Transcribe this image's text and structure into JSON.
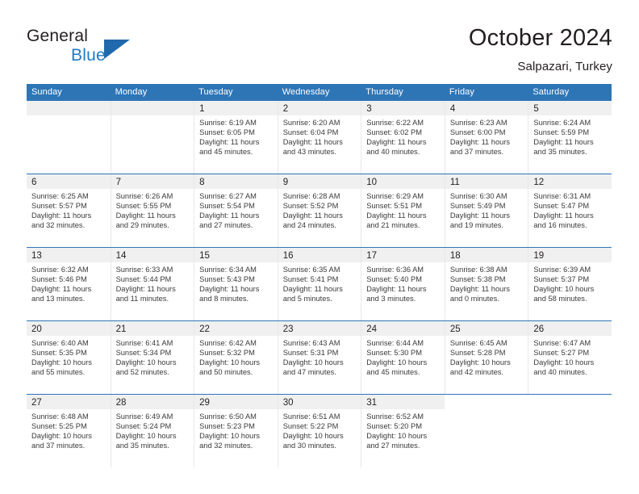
{
  "brand": {
    "name_top": "General",
    "name_bottom": "Blue",
    "logo_icon": "triangle-logo-icon",
    "accent_color": "#2069ac"
  },
  "header": {
    "title": "October 2024",
    "subtitle": "Salpazari, Turkey"
  },
  "colors": {
    "header_blue": "#2e75b6",
    "daynum_band": "#f0f0f0",
    "brand_blue": "#1f7bc1"
  },
  "calendar": {
    "day_headers": [
      "Sunday",
      "Monday",
      "Tuesday",
      "Wednesday",
      "Thursday",
      "Friday",
      "Saturday"
    ],
    "weeks": [
      [
        {
          "day": "",
          "detail": ""
        },
        {
          "day": "",
          "detail": ""
        },
        {
          "day": "1",
          "detail": "Sunrise: 6:19 AM\nSunset: 6:05 PM\nDaylight: 11 hours\nand 45 minutes."
        },
        {
          "day": "2",
          "detail": "Sunrise: 6:20 AM\nSunset: 6:04 PM\nDaylight: 11 hours\nand 43 minutes."
        },
        {
          "day": "3",
          "detail": "Sunrise: 6:22 AM\nSunset: 6:02 PM\nDaylight: 11 hours\nand 40 minutes."
        },
        {
          "day": "4",
          "detail": "Sunrise: 6:23 AM\nSunset: 6:00 PM\nDaylight: 11 hours\nand 37 minutes."
        },
        {
          "day": "5",
          "detail": "Sunrise: 6:24 AM\nSunset: 5:59 PM\nDaylight: 11 hours\nand 35 minutes."
        }
      ],
      [
        {
          "day": "6",
          "detail": "Sunrise: 6:25 AM\nSunset: 5:57 PM\nDaylight: 11 hours\nand 32 minutes."
        },
        {
          "day": "7",
          "detail": "Sunrise: 6:26 AM\nSunset: 5:55 PM\nDaylight: 11 hours\nand 29 minutes."
        },
        {
          "day": "8",
          "detail": "Sunrise: 6:27 AM\nSunset: 5:54 PM\nDaylight: 11 hours\nand 27 minutes."
        },
        {
          "day": "9",
          "detail": "Sunrise: 6:28 AM\nSunset: 5:52 PM\nDaylight: 11 hours\nand 24 minutes."
        },
        {
          "day": "10",
          "detail": "Sunrise: 6:29 AM\nSunset: 5:51 PM\nDaylight: 11 hours\nand 21 minutes."
        },
        {
          "day": "11",
          "detail": "Sunrise: 6:30 AM\nSunset: 5:49 PM\nDaylight: 11 hours\nand 19 minutes."
        },
        {
          "day": "12",
          "detail": "Sunrise: 6:31 AM\nSunset: 5:47 PM\nDaylight: 11 hours\nand 16 minutes."
        }
      ],
      [
        {
          "day": "13",
          "detail": "Sunrise: 6:32 AM\nSunset: 5:46 PM\nDaylight: 11 hours\nand 13 minutes."
        },
        {
          "day": "14",
          "detail": "Sunrise: 6:33 AM\nSunset: 5:44 PM\nDaylight: 11 hours\nand 11 minutes."
        },
        {
          "day": "15",
          "detail": "Sunrise: 6:34 AM\nSunset: 5:43 PM\nDaylight: 11 hours\nand 8 minutes."
        },
        {
          "day": "16",
          "detail": "Sunrise: 6:35 AM\nSunset: 5:41 PM\nDaylight: 11 hours\nand 5 minutes."
        },
        {
          "day": "17",
          "detail": "Sunrise: 6:36 AM\nSunset: 5:40 PM\nDaylight: 11 hours\nand 3 minutes."
        },
        {
          "day": "18",
          "detail": "Sunrise: 6:38 AM\nSunset: 5:38 PM\nDaylight: 11 hours\nand 0 minutes."
        },
        {
          "day": "19",
          "detail": "Sunrise: 6:39 AM\nSunset: 5:37 PM\nDaylight: 10 hours\nand 58 minutes."
        }
      ],
      [
        {
          "day": "20",
          "detail": "Sunrise: 6:40 AM\nSunset: 5:35 PM\nDaylight: 10 hours\nand 55 minutes."
        },
        {
          "day": "21",
          "detail": "Sunrise: 6:41 AM\nSunset: 5:34 PM\nDaylight: 10 hours\nand 52 minutes."
        },
        {
          "day": "22",
          "detail": "Sunrise: 6:42 AM\nSunset: 5:32 PM\nDaylight: 10 hours\nand 50 minutes."
        },
        {
          "day": "23",
          "detail": "Sunrise: 6:43 AM\nSunset: 5:31 PM\nDaylight: 10 hours\nand 47 minutes."
        },
        {
          "day": "24",
          "detail": "Sunrise: 6:44 AM\nSunset: 5:30 PM\nDaylight: 10 hours\nand 45 minutes."
        },
        {
          "day": "25",
          "detail": "Sunrise: 6:45 AM\nSunset: 5:28 PM\nDaylight: 10 hours\nand 42 minutes."
        },
        {
          "day": "26",
          "detail": "Sunrise: 6:47 AM\nSunset: 5:27 PM\nDaylight: 10 hours\nand 40 minutes."
        }
      ],
      [
        {
          "day": "27",
          "detail": "Sunrise: 6:48 AM\nSunset: 5:25 PM\nDaylight: 10 hours\nand 37 minutes."
        },
        {
          "day": "28",
          "detail": "Sunrise: 6:49 AM\nSunset: 5:24 PM\nDaylight: 10 hours\nand 35 minutes."
        },
        {
          "day": "29",
          "detail": "Sunrise: 6:50 AM\nSunset: 5:23 PM\nDaylight: 10 hours\nand 32 minutes."
        },
        {
          "day": "30",
          "detail": "Sunrise: 6:51 AM\nSunset: 5:22 PM\nDaylight: 10 hours\nand 30 minutes."
        },
        {
          "day": "31",
          "detail": "Sunrise: 6:52 AM\nSunset: 5:20 PM\nDaylight: 10 hours\nand 27 minutes."
        },
        {
          "day": "",
          "detail": ""
        },
        {
          "day": "",
          "detail": ""
        }
      ]
    ]
  }
}
